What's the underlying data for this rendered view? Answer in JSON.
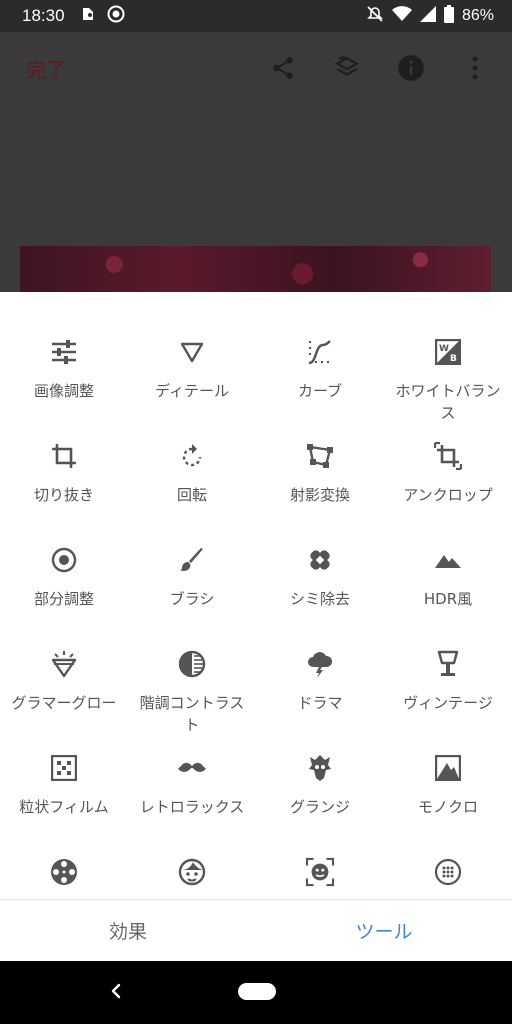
{
  "status_bar": {
    "time": "18:30",
    "left_icons": [
      "evernote-icon",
      "sync-icon"
    ],
    "right_icons": [
      "mute-icon",
      "wifi-icon",
      "signal-icon",
      "battery-icon"
    ],
    "battery": "86%"
  },
  "app_bar": {
    "done_label": "完了",
    "actions": [
      "share-icon",
      "history-icon",
      "info-icon",
      "more-vert-icon"
    ]
  },
  "tools": [
    {
      "label": "画像調整",
      "icon": "tune-icon"
    },
    {
      "label": "ディテール",
      "icon": "triangle-icon"
    },
    {
      "label": "カーブ",
      "icon": "curves-icon"
    },
    {
      "label": "ホワイトバランス",
      "icon": "white-balance-icon"
    },
    {
      "label": "切り抜き",
      "icon": "crop-icon"
    },
    {
      "label": "回転",
      "icon": "rotate-icon"
    },
    {
      "label": "射影変換",
      "icon": "perspective-icon"
    },
    {
      "label": "アンクロップ",
      "icon": "expand-icon"
    },
    {
      "label": "部分調整",
      "icon": "selective-icon"
    },
    {
      "label": "ブラシ",
      "icon": "brush-icon"
    },
    {
      "label": "シミ除去",
      "icon": "healing-icon"
    },
    {
      "label": "HDR風",
      "icon": "hdr-icon"
    },
    {
      "label": "グラマーグロー",
      "icon": "glamour-icon"
    },
    {
      "label": "階調コントラスト",
      "icon": "tonal-contrast-icon"
    },
    {
      "label": "ドラマ",
      "icon": "drama-icon"
    },
    {
      "label": "ヴィンテージ",
      "icon": "vintage-icon"
    },
    {
      "label": "粒状フィルム",
      "icon": "grainy-film-icon"
    },
    {
      "label": "レトロラックス",
      "icon": "mustache-icon"
    },
    {
      "label": "グランジ",
      "icon": "grunge-icon"
    },
    {
      "label": "モノクロ",
      "icon": "bw-icon"
    },
    {
      "label": "",
      "icon": "film-reel-icon"
    },
    {
      "label": "",
      "icon": "face-icon"
    },
    {
      "label": "",
      "icon": "face-frame-icon"
    },
    {
      "label": "",
      "icon": "dots-circle-icon"
    }
  ],
  "tabs": {
    "effects": "効果",
    "tools": "ツール"
  },
  "colors": {
    "accent": "#3d86d6",
    "icon": "#555555",
    "done": "#5b1a1e"
  }
}
